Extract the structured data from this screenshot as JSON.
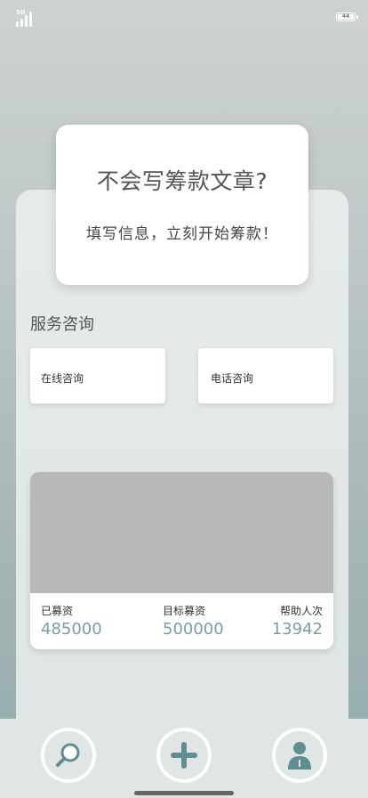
{
  "status_bar": {
    "network": "5G",
    "battery": "44"
  },
  "hero": {
    "title": "不会写筹款文章?",
    "subtitle": "填写信息，立刻开始筹款！"
  },
  "service": {
    "title": "服务咨询",
    "online_label": "在线咨询",
    "phone_label": "电话咨询"
  },
  "stats": {
    "raised_label": "已募资",
    "raised_value": "485000",
    "target_label": "目标募资",
    "target_value": "500000",
    "helpers_label": "帮助人次",
    "helpers_value": "13942"
  },
  "tabbar": {
    "items": [
      {
        "icon": "search-icon"
      },
      {
        "icon": "plus-icon"
      },
      {
        "icon": "person-icon"
      }
    ]
  },
  "colors": {
    "accent": "#5f8d90",
    "stat_value": "#7a9ea0"
  }
}
